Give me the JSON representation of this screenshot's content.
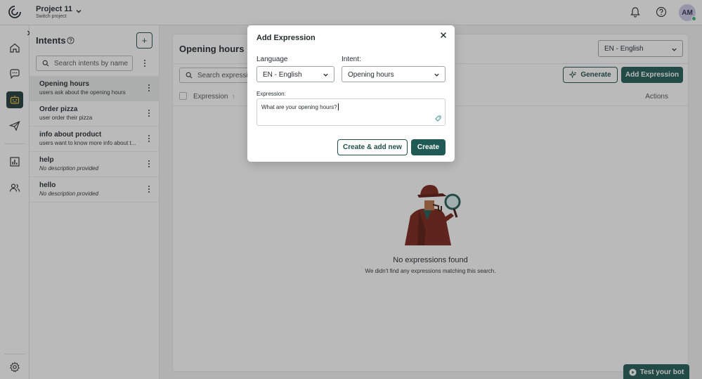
{
  "header": {
    "project_name": "Project 11",
    "project_sub": "Switch project",
    "avatar_initials": "AM"
  },
  "rail": {
    "icons": [
      "home-icon",
      "chat-icon",
      "bot-icon",
      "send-icon",
      "analytics-icon",
      "users-icon",
      "settings-icon"
    ]
  },
  "intents": {
    "title": "Intents",
    "search_placeholder": "Search intents by name",
    "items": [
      {
        "name": "Opening hours",
        "description": "users ask about the opening hours"
      },
      {
        "name": "Order pizza",
        "description": "user order their pizza"
      },
      {
        "name": "info about product",
        "description": "users want to know more info about t..."
      },
      {
        "name": "help",
        "description": "No description provided"
      },
      {
        "name": "hello",
        "description": "No description provided"
      }
    ]
  },
  "main": {
    "title": "Opening hours",
    "language": "EN - English",
    "search_placeholder": "Search expressions",
    "generate_label": "Generate",
    "add_expression_label": "Add Expression",
    "col_expression": "Expression",
    "col_actions": "Actions",
    "empty_title": "No expressions found",
    "empty_sub": "We didn't find any expressions matching this search."
  },
  "test_bot_label": "Test your bot",
  "modal": {
    "title": "Add Expression",
    "language_label": "Language",
    "language_value": "EN - English",
    "intent_label": "Intent:",
    "intent_value": "Opening hours",
    "expression_label": "Expression:",
    "expression_value": "What are your opening hours?",
    "create_add_new_label": "Create & add new",
    "create_label": "Create"
  },
  "colors": {
    "primary": "#1f5a54",
    "active_rail": "#1f3a38"
  }
}
